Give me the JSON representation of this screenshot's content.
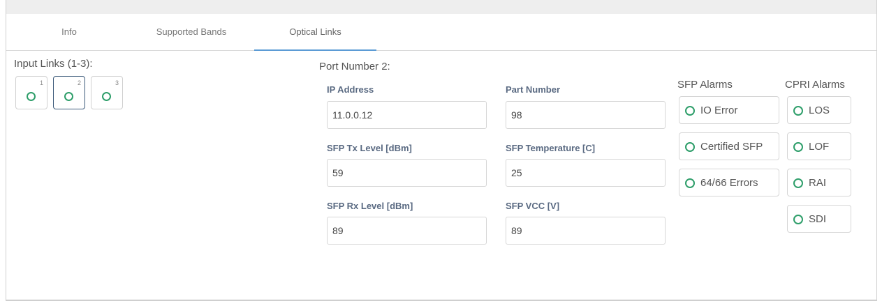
{
  "tabs": [
    {
      "label": "Info",
      "active": false
    },
    {
      "label": "Supported Bands",
      "active": false
    },
    {
      "label": "Optical Links",
      "active": true
    }
  ],
  "input_links": {
    "title": "Input Links (1-3):",
    "links": [
      {
        "number": "1",
        "selected": false
      },
      {
        "number": "2",
        "selected": true
      },
      {
        "number": "3",
        "selected": false
      }
    ]
  },
  "port": {
    "title": "Port Number 2:",
    "fields": {
      "ip_address": {
        "label": "IP Address",
        "value": "11.0.0.12"
      },
      "part_number": {
        "label": "Part Number",
        "value": "98"
      },
      "sfp_tx_level": {
        "label": "SFP Tx Level [dBm]",
        "value": "59"
      },
      "sfp_temperature": {
        "label": "SFP Temperature [C]",
        "value": "25"
      },
      "sfp_rx_level": {
        "label": "SFP Rx Level [dBm]",
        "value": "89"
      },
      "sfp_vcc": {
        "label": "SFP VCC [V]",
        "value": "89"
      }
    }
  },
  "sfp_alarms": {
    "title": "SFP Alarms",
    "items": [
      {
        "label": "IO Error"
      },
      {
        "label": "Certified SFP"
      },
      {
        "label": "64/66 Errors"
      }
    ]
  },
  "cpri_alarms": {
    "title": "CPRI Alarms",
    "items": [
      {
        "label": "LOS"
      },
      {
        "label": "LOF"
      },
      {
        "label": "RAI"
      },
      {
        "label": "SDI"
      }
    ]
  },
  "colors": {
    "ok_indicator": "#2e9e6a",
    "tab_accent": "#5b9bd5",
    "selected_border": "#3c5a7a"
  }
}
